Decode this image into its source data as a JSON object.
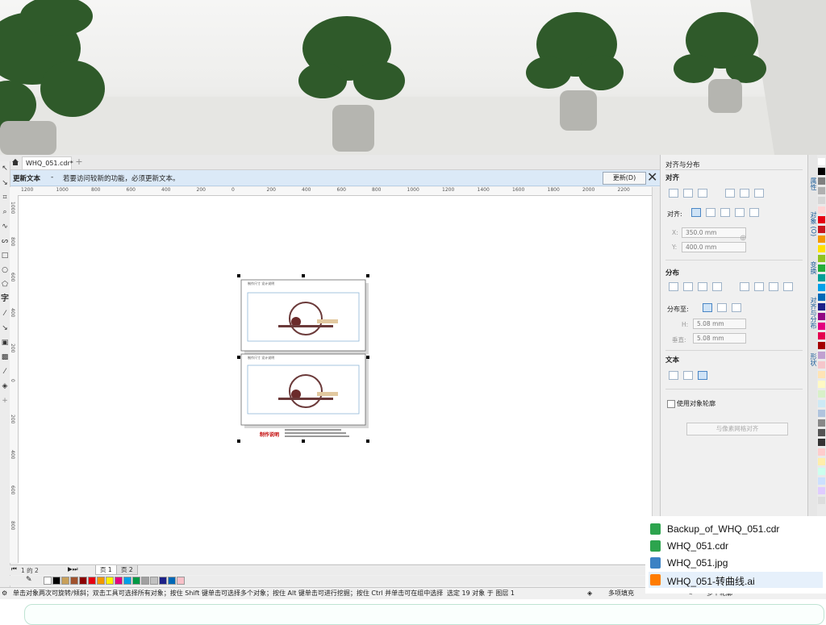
{
  "tab": {
    "doc_name": "WHQ_051.cdr*",
    "add_label": "+"
  },
  "notification": {
    "title": "更新文本",
    "dash": "-",
    "message": "若要访问较新的功能，必须更新文本。",
    "update_button": "更新(D)",
    "close_label": "✕"
  },
  "ruler": {
    "h_labels": [
      "1200",
      "1000",
      "800",
      "600",
      "400",
      "200",
      "0",
      "200",
      "400",
      "600",
      "800",
      "1000",
      "1200",
      "1400",
      "1600",
      "1800",
      "2000",
      "2200"
    ],
    "v_labels": [
      "1000",
      "800",
      "600",
      "400",
      "200",
      "0",
      "200",
      "400",
      "600",
      "800"
    ]
  },
  "artboard": {
    "caption": "制作说明",
    "small_text": "制作尺寸 设计说明"
  },
  "pagebar": {
    "info": "1 的 2",
    "page1": "页 1",
    "page2": "页 2"
  },
  "palette_colors": [
    "#ffffff",
    "#000000",
    "#c8a05a",
    "#a0522d",
    "#8b0000",
    "#e60012",
    "#f39800",
    "#fff100",
    "#e4007f",
    "#00a0e9",
    "#009944",
    "#a0a0a0",
    "#c0c0c0",
    "#1d2088",
    "#0068b7",
    "#f8c0c8"
  ],
  "status": {
    "hint": "单击对象两次可旋转/倾斜；双击工具可选择所有对象；按住 Shift 键单击可选择多个对象；按住 Alt 键单击可进行挖掘；按住 Ctrl 并单击可在组中选择",
    "selection": "选定 19 对象 于 图层 1",
    "fill": "多项填充",
    "outline": "多个轮廓"
  },
  "dock": {
    "title": "对齐与分布",
    "align_header": "对齐",
    "align_to_label": "对齐:",
    "x_label": "X:",
    "x_value": "350.0 mm",
    "y_label": "Y:",
    "y_value": "400.0 mm",
    "distribute_header": "分布",
    "distribute_to_label": "分布至:",
    "h_label": "H:",
    "h_value": "5.08 mm",
    "spacing_label": "垂直:",
    "spacing_value": "5.08 mm",
    "text_header": "文本",
    "checkbox_label": "使用对象轮廓",
    "grid_button": "与像素网格对齐"
  },
  "side_tabs": [
    "属性",
    "对象 (O)",
    "变换",
    "对齐与分布",
    "形状"
  ],
  "files": [
    {
      "name": "Backup_of_WHQ_051.cdr",
      "icon": "cdr-icon",
      "color": "#2da44e"
    },
    {
      "name": "WHQ_051.cdr",
      "icon": "cdr-icon",
      "color": "#2da44e"
    },
    {
      "name": "WHQ_051.jpg",
      "icon": "jpg-icon",
      "color": "#3b82c4"
    },
    {
      "name": "WHQ_051-转曲线.ai",
      "icon": "ai-icon",
      "color": "#ff7c00"
    }
  ]
}
